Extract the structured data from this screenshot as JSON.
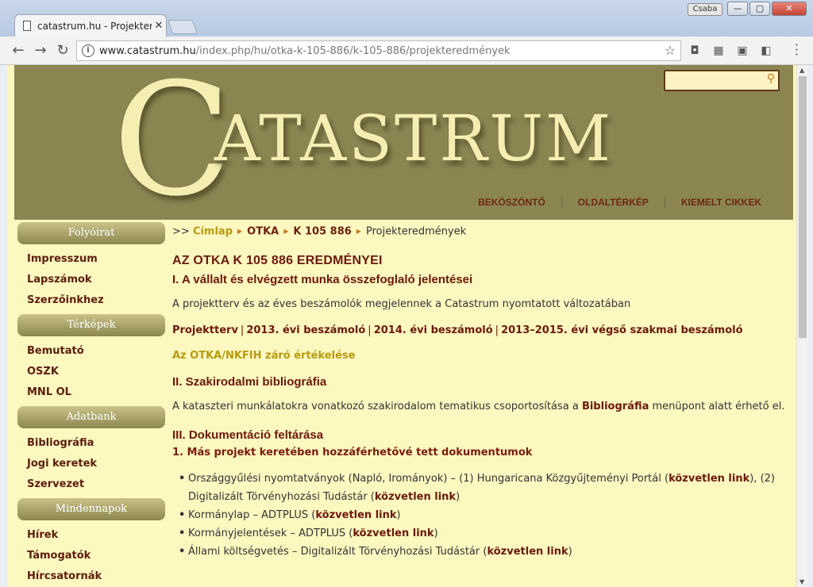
{
  "browser": {
    "tab_title": "catastrum.hu - Projekter",
    "tab_close": "✕",
    "user_badge": "Csaba",
    "url_host": "www.catastrum.hu",
    "url_path": "/index.php/hu/otka-k-105-886/k-105-886/projekteredmények",
    "win_minimize": "—",
    "win_maximize": "▢",
    "win_close": "✕"
  },
  "site": {
    "logo_initial": "C",
    "logo_rest": "ATASTRUM",
    "search_placeholder": "",
    "topnav": [
      "BEKÖSZÖNTŐ",
      "OLDALTÉRKÉP",
      "KIEMELT CIKKEK"
    ]
  },
  "sidebar": {
    "groups": [
      {
        "title": "Folyóirat",
        "items": [
          "Impresszum",
          "Lapszámok",
          "Szerzőinkhez"
        ]
      },
      {
        "title": "Térképek",
        "items": [
          "Bemutató",
          "OSZK",
          "MNL OL"
        ]
      },
      {
        "title": "Adatbank",
        "items": [
          "Bibliográfia",
          "Jogi keretek",
          "Szervezet"
        ]
      },
      {
        "title": "Mindennapok",
        "items": [
          "Hírek",
          "Támogatók",
          "Hírcsatornák"
        ]
      }
    ]
  },
  "breadcrumb": {
    "prefix": ">>",
    "home": "Címlap",
    "otka": "OTKA",
    "project": "K 105 886",
    "current": "Projekteredmények"
  },
  "main": {
    "title": "AZ OTKA K 105 886 EREDMÉNYEI",
    "section1_title": "I. A vállalt és elvégzett munka összefoglaló jelentései",
    "section1_text": "A projektterv és az éves beszámolók megjelennek a Catastrum nyomtatott változatában",
    "report_links": [
      "Projektterv",
      "2013. évi beszámoló",
      "2014. évi beszámoló",
      "2013–2015. évi végső szakmai beszámoló"
    ],
    "pipe": "|",
    "final_eval_link": "Az OTKA/NKFIH záró értékelése",
    "section2_title": "II. Szakirodalmi bibliográfia",
    "section2_text_before": "A kataszteri munkálatokra vonatkozó szakirodalom tematikus csoportosítása a",
    "section2_link": "Bibliográfia",
    "section2_text_after": "menüpont alatt érhető el.",
    "section3_title": "III. Dokumentáció feltárása",
    "section3_sub": "1. Más projekt keretében hozzáférhetővé tett dokumentumok",
    "bullets": [
      {
        "a": "Országgyűlési nyomtatványok (Napló, Irományok) – (1) Hungaricana Közgyűjteményi Portál (",
        "l1": "közvetlen link",
        "b": "), (2) Digitalizált Törvényhozási Tudástár (",
        "l2": "közvetlen link",
        "c": ")"
      },
      {
        "a": "Kormánylap – ADTPLUS (",
        "l1": "közvetlen link",
        "b": ")"
      },
      {
        "a": "Kormányjelentések – ADTPLUS (",
        "l1": "közvetlen link",
        "b": ")"
      },
      {
        "a": "Állami költségvetés – Digitalizált Törvényhozási Tudástár (",
        "l1": "közvetlen link",
        "b": ")"
      }
    ]
  },
  "colors": {
    "banner": "#8b8552",
    "page_bg": "#fdf7c0",
    "link_dark": "#6b1a0a",
    "link_yellow": "#b59b0f"
  }
}
